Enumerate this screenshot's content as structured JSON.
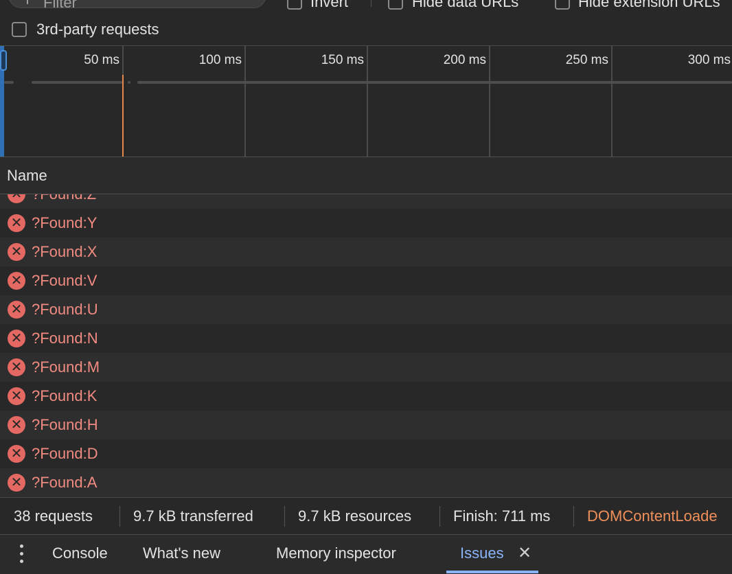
{
  "filter": {
    "placeholder": "Filter",
    "invert_label": "Invert",
    "hide_data_urls_label": "Hide data URLs",
    "hide_extension_urls_label": "Hide extension URLs"
  },
  "third_party": {
    "label": "3rd-party requests"
  },
  "overview": {
    "ticks": [
      "50 ms",
      "100 ms",
      "150 ms",
      "200 ms",
      "250 ms",
      "300 ms"
    ]
  },
  "table": {
    "header": "Name",
    "rows": [
      "?Found:Z",
      "?Found:Y",
      "?Found:X",
      "?Found:V",
      "?Found:U",
      "?Found:N",
      "?Found:M",
      "?Found:K",
      "?Found:H",
      "?Found:D",
      "?Found:A"
    ]
  },
  "summary": {
    "requests": "38 requests",
    "transferred": "9.7 kB transferred",
    "resources": "9.7 kB resources",
    "finish": "Finish: 711 ms",
    "dom_content_loaded": "DOMContentLoade"
  },
  "drawer": {
    "tabs": [
      "Console",
      "What's new",
      "Memory inspector",
      "Issues"
    ],
    "active_tab": "Issues",
    "close_symbol": "✕"
  },
  "colors": {
    "accent": "#8ab4f8",
    "error": "#e46962",
    "error_text": "#f28b82",
    "dcl_orange": "#ef8f59",
    "marker_orange": "#e5894b"
  }
}
